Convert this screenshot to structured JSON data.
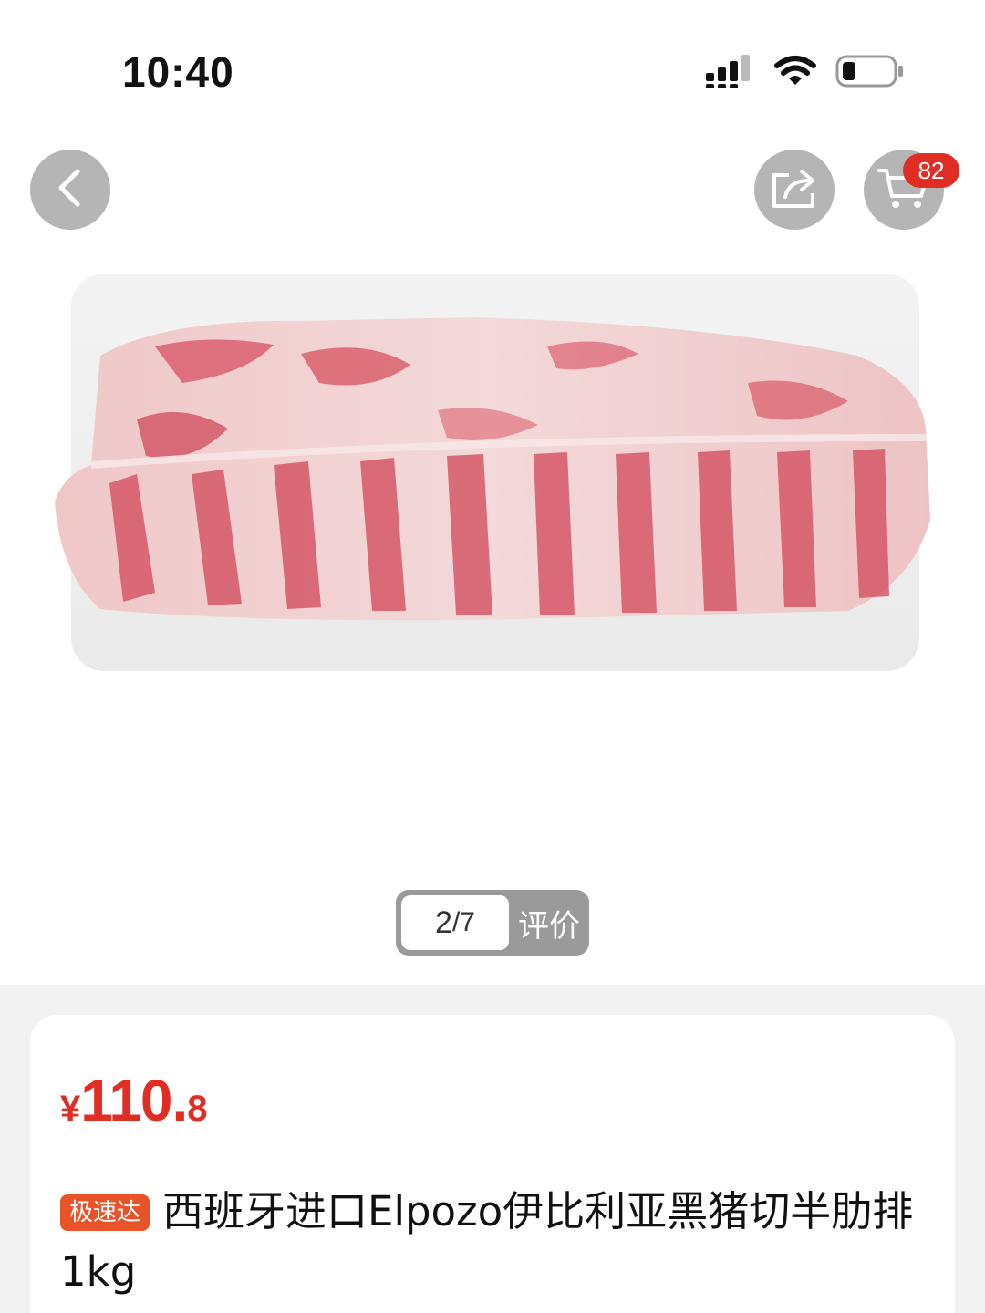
{
  "status_bar": {
    "time": "10:40"
  },
  "nav": {
    "back_icon": "chevron-left-icon",
    "share_icon": "share-icon",
    "cart_icon": "cart-icon",
    "cart_badge": "82"
  },
  "gallery": {
    "count_current": "2",
    "count_total": "/7",
    "review_label": "评价"
  },
  "product": {
    "price_symbol": "¥",
    "price_integer": "110.",
    "price_decimal": "8",
    "tag": "极速达",
    "title": "西班牙进口Elpozo伊比利亚黑猪切半肋排1kg"
  },
  "colors": {
    "accent_red": "#e02e24",
    "tag_orange": "#e8532a",
    "page_grey": "#f2f2f2"
  }
}
